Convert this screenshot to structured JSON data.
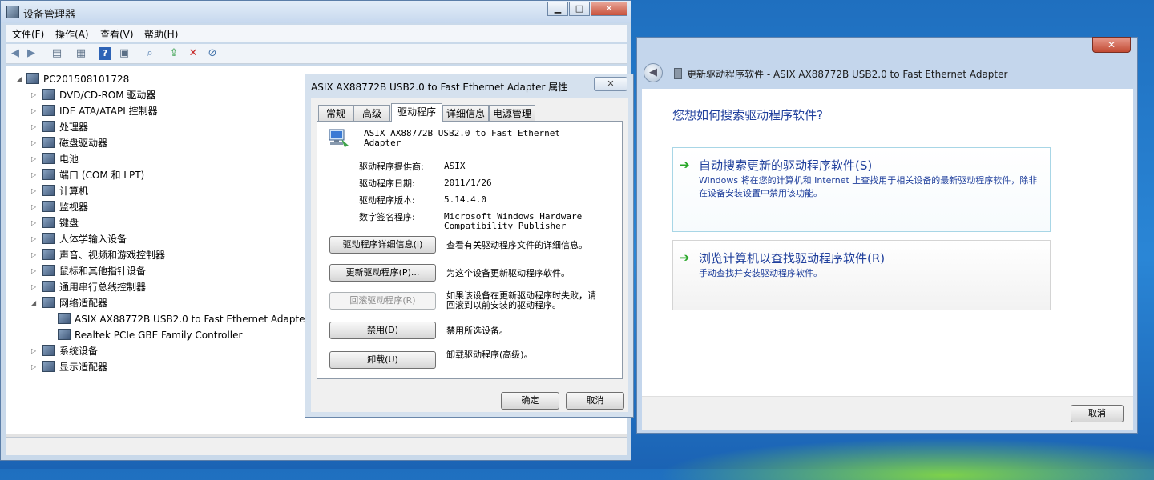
{
  "device_manager": {
    "title": "设备管理器",
    "menu": [
      "文件(F)",
      "操作(A)",
      "查看(V)",
      "帮助(H)"
    ],
    "root": "PC201508101728",
    "categories": [
      {
        "label": "DVD/CD-ROM 驱动器",
        "icon": "optical-drive-icon"
      },
      {
        "label": "IDE ATA/ATAPI 控制器",
        "icon": "ide-controller-icon"
      },
      {
        "label": "处理器",
        "icon": "processor-icon"
      },
      {
        "label": "磁盘驱动器",
        "icon": "disk-drive-icon"
      },
      {
        "label": "电池",
        "icon": "battery-icon"
      },
      {
        "label": "端口 (COM 和 LPT)",
        "icon": "port-icon"
      },
      {
        "label": "计算机",
        "icon": "computer-icon"
      },
      {
        "label": "监视器",
        "icon": "monitor-icon"
      },
      {
        "label": "键盘",
        "icon": "keyboard-icon"
      },
      {
        "label": "人体学输入设备",
        "icon": "hid-icon"
      },
      {
        "label": "声音、视频和游戏控制器",
        "icon": "speaker-icon"
      },
      {
        "label": "鼠标和其他指针设备",
        "icon": "mouse-icon"
      },
      {
        "label": "通用串行总线控制器",
        "icon": "usb-icon"
      },
      {
        "label": "网络适配器",
        "icon": "network-adapter-icon",
        "expanded": true
      },
      {
        "label": "系统设备",
        "icon": "system-device-icon"
      },
      {
        "label": "显示适配器",
        "icon": "display-adapter-icon"
      }
    ],
    "network_children": [
      "ASIX AX88772B USB2.0 to Fast Ethernet Adapter",
      "Realtek PCIe GBE Family Controller"
    ]
  },
  "properties": {
    "title": "ASIX AX88772B USB2.0 to Fast Ethernet Adapter 属性",
    "close_label": "✕",
    "tabs": [
      "常规",
      "高级",
      "驱动程序",
      "详细信息",
      "电源管理"
    ],
    "active_tab": "驱动程序",
    "device_name_line1": "ASIX AX88772B USB2.0 to Fast Ethernet",
    "device_name_line2": "Adapter",
    "fields": [
      {
        "label": "驱动程序提供商:",
        "value": "ASIX"
      },
      {
        "label": "驱动程序日期:",
        "value": "2011/1/26"
      },
      {
        "label": "驱动程序版本:",
        "value": "5.14.4.0"
      },
      {
        "label": "数字签名程序:",
        "value": "Microsoft Windows Hardware",
        "value2": "Compatibility Publisher"
      }
    ],
    "actions": [
      {
        "button": "驱动程序详细信息(I)",
        "desc": "查看有关驱动程序文件的详细信息。",
        "enabled": true
      },
      {
        "button": "更新驱动程序(P)...",
        "desc": "为这个设备更新驱动程序软件。",
        "enabled": true
      },
      {
        "button": "回滚驱动程序(R)",
        "desc": "如果该设备在更新驱动程序时失败，请",
        "desc2": "回滚到以前安装的驱动程序。",
        "enabled": false
      },
      {
        "button": "禁用(D)",
        "desc": "禁用所选设备。",
        "enabled": true
      },
      {
        "button": "卸载(U)",
        "desc": "卸载驱动程序(高级)。",
        "enabled": true
      }
    ],
    "ok_label": "确定",
    "cancel_label": "取消"
  },
  "wizard": {
    "header": "更新驱动程序软件 - ASIX AX88772B USB2.0 to Fast Ethernet Adapter",
    "close_label": "✕",
    "question": "您想如何搜索驱动程序软件?",
    "option1_title": "自动搜索更新的驱动程序软件(S)",
    "option1_desc": "Windows 将在您的计算机和 Internet 上查找用于相关设备的最新驱动程序软件，除非在设备安装设置中禁用该功能。",
    "option2_title": "浏览计算机以查找驱动程序软件(R)",
    "option2_desc": "手动查找并安装驱动程序软件。",
    "cancel_label": "取消"
  }
}
